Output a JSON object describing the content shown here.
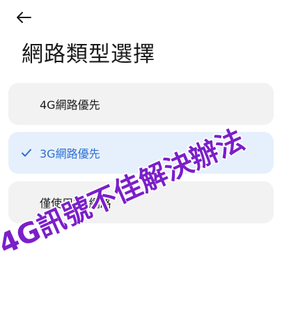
{
  "header": {
    "title": "網路類型選擇",
    "back_icon": "arrow-left-icon"
  },
  "options": [
    {
      "label": "4G網路優先",
      "selected": false
    },
    {
      "label": "3G網路優先",
      "selected": true
    },
    {
      "label": "僅使用2G網路",
      "selected": false
    }
  ],
  "overlay": {
    "text": "4G訊號不佳解決辦法"
  },
  "colors": {
    "accent": "#2c6fd1",
    "selected_bg": "#e6f0fc",
    "card_bg": "#f2f2f2",
    "overlay_text": "#7b1fc9",
    "overlay_outline": "#ffffff"
  }
}
